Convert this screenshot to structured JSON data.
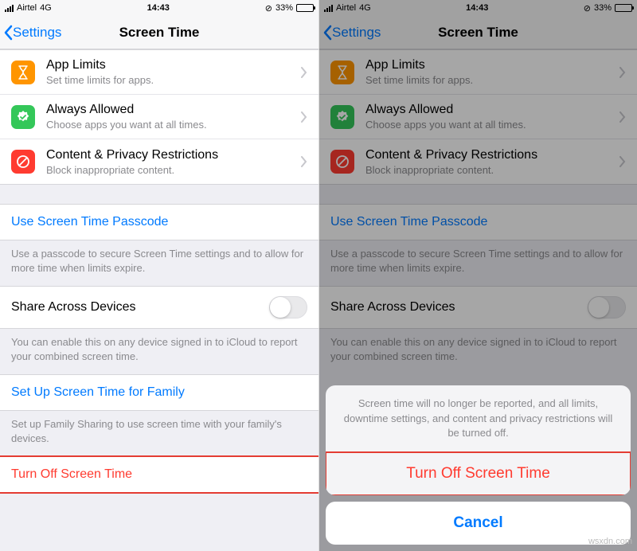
{
  "status": {
    "carrier": "Airtel",
    "network": "4G",
    "time": "14:43",
    "battery_pct": "33%"
  },
  "nav": {
    "back": "Settings",
    "title": "Screen Time"
  },
  "items": {
    "app_limits": {
      "title": "App Limits",
      "sub": "Set time limits for apps."
    },
    "always_allowed": {
      "title": "Always Allowed",
      "sub": "Choose apps you want at all times."
    },
    "content": {
      "title": "Content & Privacy Restrictions",
      "sub": "Block inappropriate content."
    }
  },
  "passcode": {
    "label": "Use Screen Time Passcode",
    "footer": "Use a passcode to secure Screen Time settings and to allow for more time when limits expire."
  },
  "share": {
    "label": "Share Across Devices",
    "footer": "You can enable this on any device signed in to iCloud to report your combined screen time."
  },
  "family": {
    "label": "Set Up Screen Time for Family",
    "footer": "Set up Family Sharing to use screen time with your family's devices."
  },
  "turn_off": {
    "label": "Turn Off Screen Time"
  },
  "sheet": {
    "message": "Screen time will no longer be reported, and all limits, downtime settings, and content and privacy restrictions will be turned off.",
    "confirm": "Turn Off Screen Time",
    "cancel": "Cancel"
  },
  "watermark": "wsxdn.com"
}
